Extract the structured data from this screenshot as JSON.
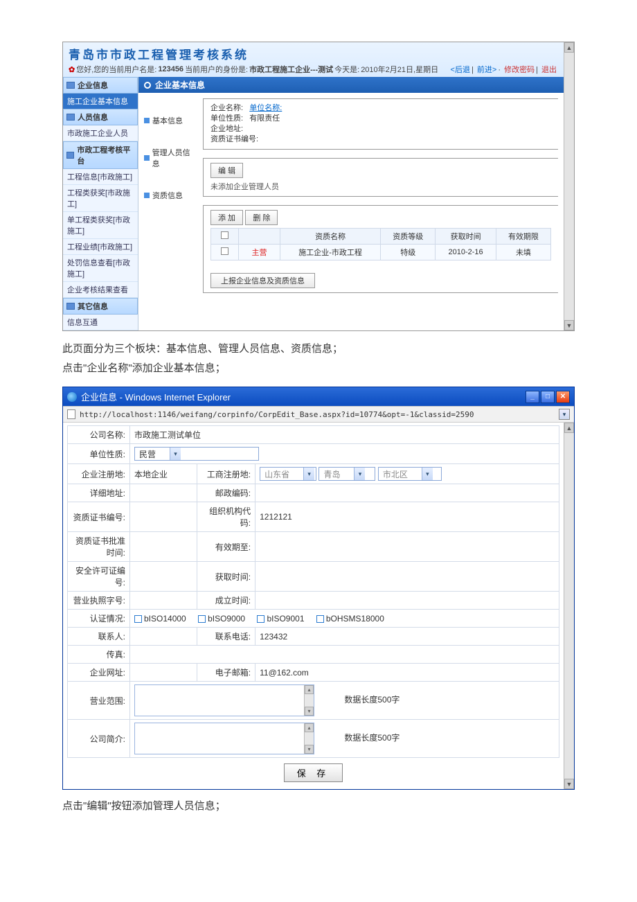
{
  "shot1": {
    "app_title": "青岛市市政工程管理考核系统",
    "status_left_prefix": "您好,您的当前用户名是:",
    "username": "123456",
    "status_mid1": " 当前用户的身份是:",
    "role": "市政工程施工企业---测试",
    "status_mid2": " 今天是:",
    "today": "2010年2月21日,星期日",
    "status_links": [
      "<后退",
      "前进>",
      "修改密码",
      "退出"
    ],
    "leftnav": {
      "h1": "企业信息",
      "sel1": "施工企业基本信息",
      "h2": "人员信息",
      "i2a": "市政施工企业人员",
      "h3": "市政工程考核平台",
      "i3": [
        "工程信息[市政施工]",
        "工程类获奖[市政施工]",
        "单工程类获奖[市政施工]",
        "工程业绩[市政施工]",
        "处罚信息查看[市政施工]",
        "企业考核结果查看"
      ],
      "h4": "其它信息",
      "i4a": "信息互通"
    },
    "pane_title": "企业基本信息",
    "subnav": [
      "基本信息",
      "管理人员信息",
      "资质信息"
    ],
    "basic": {
      "l1": "企业名称:",
      "link": "单位名称:",
      "l2": "单位性质:",
      "v2": "有限责任",
      "l3": "企业地址:",
      "l4": "资质证书编号:"
    },
    "mgr": {
      "edit_btn": "编 辑",
      "empty": "未添加企业管理人员"
    },
    "qual": {
      "add_btn": "添 加",
      "del_btn": "删 除",
      "cols": [
        "",
        "资质名称",
        "资质等级",
        "获取时间",
        "有效期限"
      ],
      "row": {
        "flag": "主营",
        "name": "施工企业-市政工程",
        "level": "特级",
        "time": "2010-2-16",
        "valid": "未填"
      }
    },
    "report_btn": "上报企业信息及资质信息"
  },
  "caption1a": "此页面分为三个板块：基本信息、管理人员信息、资质信息；",
  "caption1b": "点击\"企业名称\"添加企业基本信息；",
  "shot2": {
    "win_title": "企业信息 - Windows Internet Explorer",
    "url": "http://localhost:1146/weifang/corpinfo/CorpEdit_Base.aspx?id=10774&opt=-1&classid=2590",
    "labels": {
      "company": "公司名称:",
      "company_v": "市政施工测试单位",
      "nature": "单位性质:",
      "nature_v": "民营",
      "regaddr": "企业注册地:",
      "regaddr_v": "本地企业",
      "bizreg": "工商注册地:",
      "dd_prov": "山东省",
      "dd_city": "青岛",
      "dd_dist": "市北区",
      "addr": "详细地址:",
      "zip": "邮政编码:",
      "certno": "资质证书编号:",
      "orgcode": "组织机构代码:",
      "orgcode_v": "1212121",
      "certtime": "资质证书批准时间:",
      "validto": "有效期至:",
      "safeno": "安全许可证编号:",
      "gettime": "获取时间:",
      "lic": "营业执照字号:",
      "est": "成立时间:",
      "cert": "认证情况:",
      "ck": [
        "bISO14000",
        "bISO9000",
        "bISO9001",
        "bOHSMS18000"
      ],
      "contact": "联系人:",
      "phone": "联系电话:",
      "phone_v": "123432",
      "fax": "传真:",
      "web": "企业网址:",
      "email": "电子邮箱:",
      "email_v": "11@162.com",
      "scope": "营业范围:",
      "intro": "公司简介:",
      "hint": "数据长度500字",
      "save": "保 存"
    }
  },
  "caption2": "点击\"编辑\"按钮添加管理人员信息；"
}
